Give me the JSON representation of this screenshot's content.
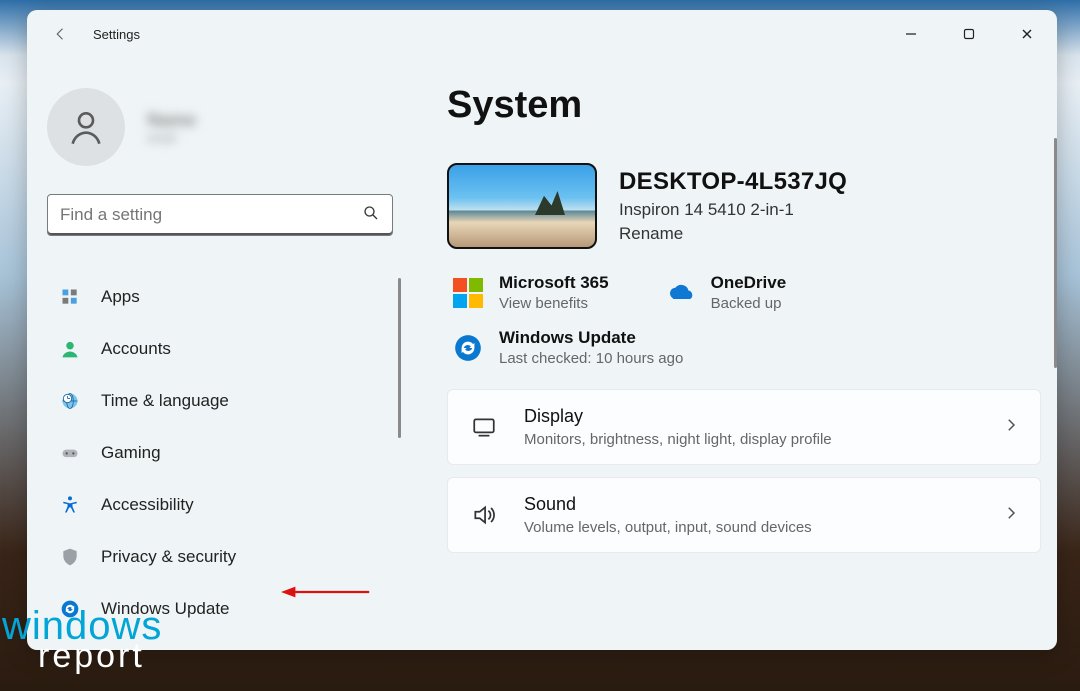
{
  "window": {
    "title": "Settings"
  },
  "user": {
    "name": "Name",
    "subtitle": "email"
  },
  "search": {
    "placeholder": "Find a setting"
  },
  "nav": {
    "items": [
      {
        "label": "Apps"
      },
      {
        "label": "Accounts"
      },
      {
        "label": "Time & language"
      },
      {
        "label": "Gaming"
      },
      {
        "label": "Accessibility"
      },
      {
        "label": "Privacy & security"
      },
      {
        "label": "Windows Update"
      }
    ]
  },
  "page": {
    "title": "System",
    "device_name": "DESKTOP-4L537JQ",
    "device_model": "Inspiron 14 5410 2-in-1",
    "rename_label": "Rename",
    "tiles": {
      "m365": {
        "title": "Microsoft 365",
        "subtitle": "View benefits"
      },
      "onedrive": {
        "title": "OneDrive",
        "subtitle": "Backed up"
      },
      "wupdate": {
        "title": "Windows Update",
        "subtitle": "Last checked: 10 hours ago"
      }
    },
    "cards": {
      "display": {
        "title": "Display",
        "subtitle": "Monitors, brightness, night light, display profile"
      },
      "sound": {
        "title": "Sound",
        "subtitle": "Volume levels, output, input, sound devices"
      }
    }
  },
  "watermark": {
    "line1": "windows",
    "line2": "report"
  }
}
